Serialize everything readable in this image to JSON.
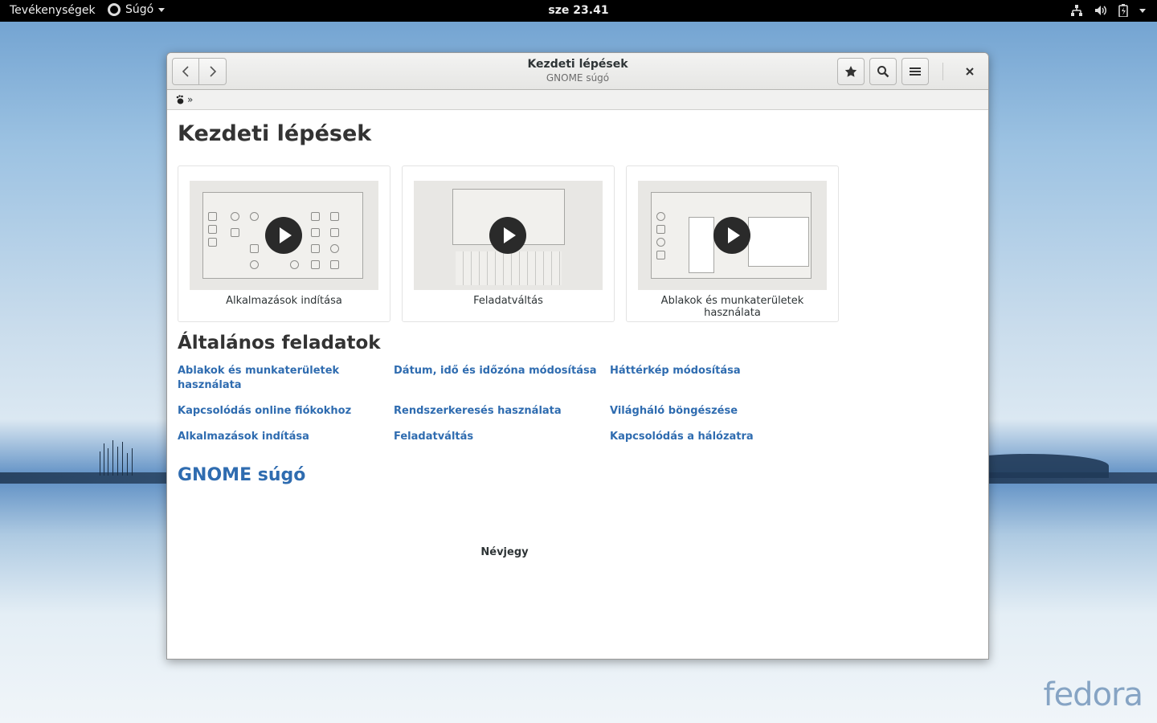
{
  "topbar": {
    "activities": "Tevékenységek",
    "app_menu": "Súgó",
    "clock": "sze 23.41",
    "icons": [
      "network-icon",
      "volume-icon",
      "battery-icon",
      "system-menu-caret-icon"
    ]
  },
  "window": {
    "title": "Kezdeti lépések",
    "subtitle": "GNOME súgó",
    "buttons": [
      "back-icon",
      "forward-icon",
      "bookmark-icon",
      "search-icon",
      "menu-icon",
      "close-icon"
    ],
    "breadcrumb": {
      "separator": "»"
    }
  },
  "page": {
    "heading": "Kezdeti lépések",
    "videos": [
      {
        "label": "Alkalmazások indítása"
      },
      {
        "label": "Feladatváltás"
      },
      {
        "label": "Ablakok és munkaterületek használata"
      }
    ],
    "tasks_heading": "Általános feladatok",
    "tasks": [
      "Ablakok és munkaterületek használata",
      "Dátum, idő és időzóna módosítása",
      "Háttérkép módosítása",
      "Kapcsolódás online fiókokhoz",
      "Rendszerkeresés használata",
      "Világháló böngészése",
      "Alkalmazások indítása",
      "Feladatváltás",
      "Kapcsolódás a hálózatra"
    ],
    "gnome_help_link": "GNOME súgó",
    "about": "Névjegy"
  },
  "wallpaper": {
    "brand": "fedora"
  },
  "colors": {
    "link": "#2f6cb0",
    "topbar": "#000000",
    "window_bg": "#ffffff"
  }
}
